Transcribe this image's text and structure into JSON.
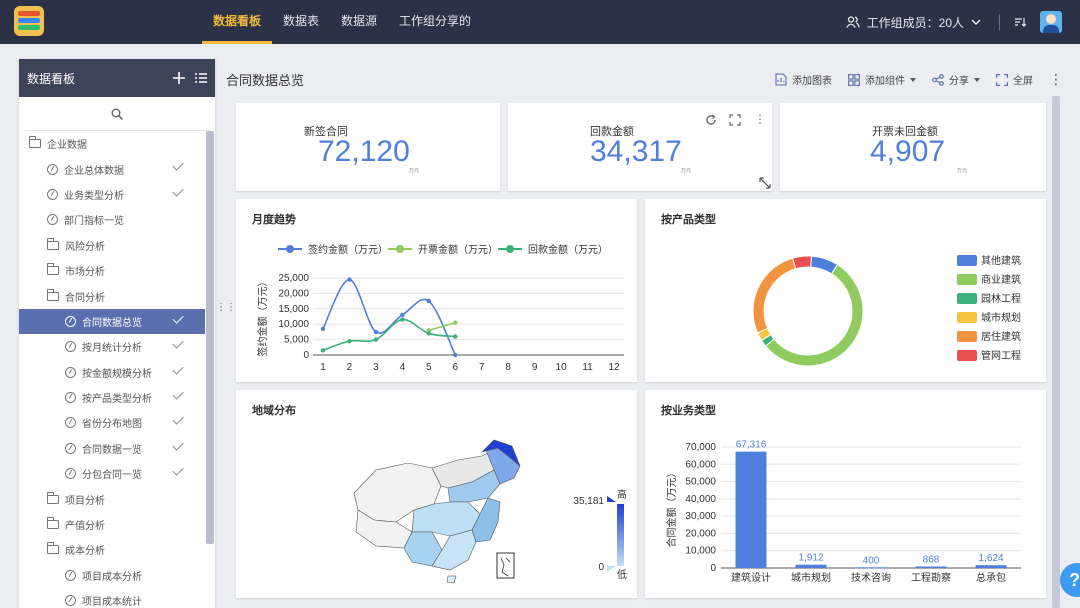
{
  "topnav": {
    "tabs": [
      {
        "label": "数据看板",
        "active": true
      },
      {
        "label": "数据表",
        "active": false
      },
      {
        "label": "数据源",
        "active": false
      },
      {
        "label": "工作组分享的",
        "active": false
      }
    ],
    "members_label": "工作组成员：20人",
    "accent_color": "#f0b93a"
  },
  "sidebar": {
    "title": "数据看板",
    "items": [
      {
        "label": "企业数据",
        "level": 0,
        "icon": "folder-open-icon"
      },
      {
        "label": "企业总体数据",
        "level": 1,
        "icon": "dashboard-icon",
        "checked": true
      },
      {
        "label": "业务类型分析",
        "level": 1,
        "icon": "dashboard-icon",
        "checked": true
      },
      {
        "label": "部门指标一览",
        "level": 1,
        "icon": "dashboard-icon",
        "checked": false
      },
      {
        "label": "风险分析",
        "level": 1,
        "icon": "folder-icon"
      },
      {
        "label": "市场分析",
        "level": 1,
        "icon": "folder-icon"
      },
      {
        "label": "合同分析",
        "level": 1,
        "icon": "folder-open-icon"
      },
      {
        "label": "合同数据总览",
        "level": 2,
        "icon": "dashboard-icon",
        "checked": true,
        "selected": true
      },
      {
        "label": "按月统计分析",
        "level": 2,
        "icon": "dashboard-icon",
        "checked": true
      },
      {
        "label": "按金额规模分析",
        "level": 2,
        "icon": "dashboard-icon",
        "checked": true
      },
      {
        "label": "按产品类型分析",
        "level": 2,
        "icon": "dashboard-icon",
        "checked": true
      },
      {
        "label": "省份分布地图",
        "level": 2,
        "icon": "dashboard-icon",
        "checked": true
      },
      {
        "label": "合同数据一览",
        "level": 2,
        "icon": "dashboard-icon",
        "checked": true
      },
      {
        "label": "分包合同一览",
        "level": 2,
        "icon": "dashboard-icon",
        "checked": true
      },
      {
        "label": "项目分析",
        "level": 1,
        "icon": "folder-icon"
      },
      {
        "label": "产值分析",
        "level": 1,
        "icon": "folder-icon"
      },
      {
        "label": "成本分析",
        "level": 1,
        "icon": "folder-open-icon"
      },
      {
        "label": "项目成本分析",
        "level": 2,
        "icon": "dashboard-icon",
        "checked": false
      },
      {
        "label": "项目成本统计",
        "level": 2,
        "icon": "dashboard-icon",
        "checked": false
      }
    ]
  },
  "page": {
    "title": "合同数据总览",
    "toolbar": {
      "add_chart": "添加图表",
      "add_widget": "添加组件",
      "share": "分享",
      "fullscreen": "全屏"
    }
  },
  "kpis": [
    {
      "label": "新签合同",
      "value": "72,120",
      "unit": "万元"
    },
    {
      "label": "回款金额",
      "value": "34,317",
      "unit": "万元"
    },
    {
      "label": "开票未回金额",
      "value": "4,907",
      "unit": "万元"
    }
  ],
  "panels": {
    "monthly": "月度趋势",
    "product": "按产品类型",
    "region": "地域分布",
    "business": "按业务类型"
  },
  "region_legend": {
    "max": "35,181",
    "min": "0",
    "high_label": "高",
    "low_label": "低"
  },
  "chart_data": [
    {
      "type": "line",
      "title": "月度趋势",
      "ylabel": "签约金额（万元）",
      "x": [
        "1",
        "2",
        "3",
        "4",
        "5",
        "6",
        "7",
        "8",
        "9",
        "10",
        "11",
        "12"
      ],
      "yticks": [
        "0",
        "5,000",
        "10,000",
        "15,000",
        "20,000",
        "25,000"
      ],
      "ylim": [
        0,
        25000
      ],
      "series": [
        {
          "name": "签约金额（万元）",
          "color": "#4f7fdc",
          "values": [
            8500,
            24500,
            7500,
            13000,
            17500,
            0,
            null,
            null,
            null,
            null,
            null,
            null
          ]
        },
        {
          "name": "开票金额（万元）",
          "color": "#8fcb5f",
          "values": [
            null,
            null,
            null,
            null,
            8000,
            10500,
            null,
            null,
            null,
            null,
            null,
            null
          ]
        },
        {
          "name": "回款金额（万元）",
          "color": "#3bb07a",
          "values": [
            1500,
            4500,
            5000,
            11500,
            7000,
            6000,
            null,
            null,
            null,
            null,
            null,
            null
          ]
        }
      ],
      "legend": "top"
    },
    {
      "type": "pie",
      "title": "按产品类型",
      "categories": [
        "其他建筑",
        "商业建筑",
        "园林工程",
        "城市规划",
        "居住建筑",
        "管网工程"
      ],
      "values": [
        8,
        55,
        2,
        2.5,
        27,
        5.5
      ],
      "colors": [
        "#4f7fdc",
        "#8fcb5f",
        "#3bb07a",
        "#f5c542",
        "#f2933f",
        "#ea4f4f"
      ],
      "legend": "right"
    },
    {
      "type": "bar",
      "title": "按业务类型",
      "ylabel": "合同金额（万元）",
      "categories": [
        "建筑设计",
        "城市规划",
        "技术咨询",
        "工程勘察",
        "总承包"
      ],
      "values": [
        67316,
        1912,
        400,
        868,
        1624
      ],
      "value_labels": [
        "67,316",
        "1,912",
        "400",
        "868",
        "1,624"
      ],
      "yticks": [
        "0",
        "10,000",
        "20,000",
        "30,000",
        "40,000",
        "50,000",
        "60,000",
        "70,000"
      ],
      "ylim": [
        0,
        70000
      ],
      "color": "#4f7fdc"
    }
  ]
}
